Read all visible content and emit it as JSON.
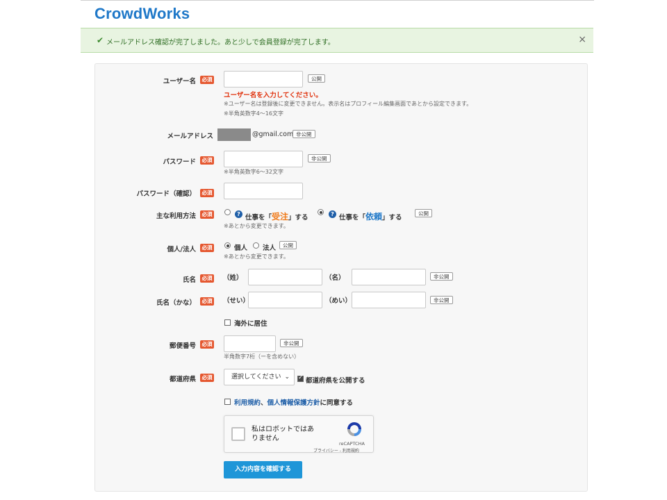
{
  "brand": {
    "logo": "CrowdWorks"
  },
  "alert": {
    "message": "メールアドレス確認が完了しました。あと少しで会員登録が完了します。",
    "close": "×"
  },
  "common": {
    "required": "必須",
    "public": "公開",
    "private": "非公開"
  },
  "username": {
    "label": "ユーザー名",
    "error": "ユーザー名を入力してください。",
    "note1": "※ユーザー名は登録後に変更できません。表示名はプロフィール編集画面であとから設定できます。",
    "note2": "※半角英数字4〜16文字"
  },
  "email": {
    "label": "メールアドレス",
    "value": "@gmail.com"
  },
  "password": {
    "label": "パスワード",
    "note": "※半角英数字6〜32文字"
  },
  "password_confirm": {
    "label": "パスワード（確認）"
  },
  "usage": {
    "label": "主な利用方法",
    "option1": {
      "pre": "仕事を「",
      "em": "受注",
      "post": "」する",
      "selected": false
    },
    "option2": {
      "pre": "仕事を「",
      "em": "依頼",
      "post": "」する",
      "selected": true
    },
    "note": "※あとから変更できます。",
    "help_icon": "question-icon"
  },
  "entity": {
    "label": "個人/法人",
    "option1": "個人",
    "option2": "法人",
    "selected": "個人",
    "note": "※あとから変更できます。"
  },
  "name": {
    "label": "氏名",
    "last": "（姓）",
    "first": "（名）"
  },
  "name_kana": {
    "label": "氏名（かな）",
    "last": "（せい）",
    "first": "（めい）"
  },
  "overseas": {
    "label": "海外に居住",
    "checked": false
  },
  "postal": {
    "label": "郵便番号",
    "note": "半角数字7桁（ーを含めない）"
  },
  "prefecture": {
    "label": "都道府県",
    "placeholder": "選択してください",
    "publish_label": "都道府県を公開する",
    "publish_checked": true
  },
  "terms": {
    "link1": "利用規約",
    "sep": "、",
    "link2": "個人情報保護方針",
    "suffix": "に同意する",
    "checked": false
  },
  "recaptcha": {
    "label": "私はロボットではありません",
    "brand": "reCAPTCHA",
    "links": "プライバシー - 利用規約"
  },
  "submit": {
    "label": "入力内容を確認する"
  },
  "colors": {
    "brand": "#1f78c8",
    "required": "#e5572f",
    "error": "#e0330e",
    "submit": "#1e96d8",
    "alert_bg": "#e8f4e1"
  }
}
